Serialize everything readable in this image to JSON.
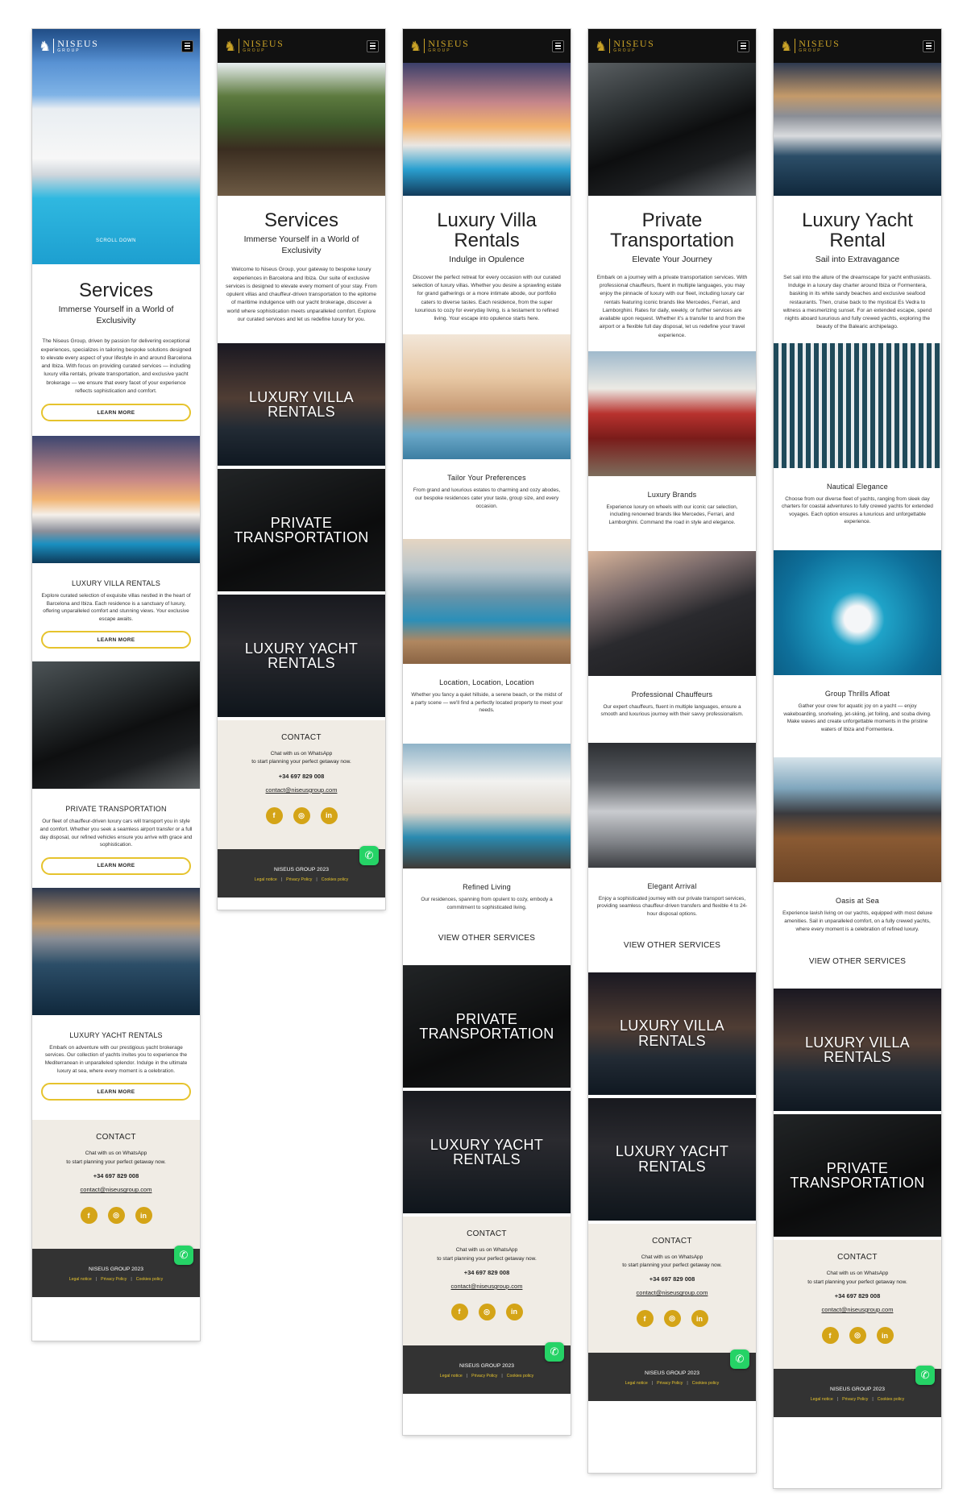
{
  "brand": {
    "name": "NISEUS",
    "tagline": "GROUP"
  },
  "icons": {
    "menu": "hamburger-menu-icon",
    "whatsapp": "whatsapp-icon",
    "facebook": "facebook-icon",
    "instagram": "instagram-icon",
    "linkedin": "linkedin-icon"
  },
  "colors": {
    "gold": "#c9a227",
    "button_border": "#e6c32d",
    "social": "#d4a417",
    "footer": "#333333",
    "contact_bg": "#f0ece5"
  },
  "contact": {
    "heading": "CONTACT",
    "line1": "Chat with us on WhatsApp",
    "line2": "to start planning your perfect getaway now.",
    "phone": "+34 697 829 008",
    "email": "contact@niseusgroup.com",
    "social": [
      "f",
      "◎",
      "in"
    ]
  },
  "footer": {
    "copyright": "NISEUS GROUP 2023",
    "legal": "Legal notice",
    "privacy": "Privacy Policy",
    "cookies": "Cookies policy",
    "sep": "|"
  },
  "home": {
    "scroll": "SCROLL DOWN",
    "title": "Services",
    "subtitle": "Immerse Yourself in a World of Exclusivity",
    "intro": "The Niseus Group, driven by passion for delivering exceptional experiences, specializes in tailoring bespoke solutions designed to elevate every aspect of your lifestyle in and around Barcelona and Ibiza. With focus on providing curated services — including luxury villa rentals, private transportation, and exclusive yacht brokerage — we ensure that every facet of your experience reflects sophistication and comfort.",
    "cta": "LEARN MORE",
    "blocks": [
      {
        "title": "LUXURY VILLA RENTALS",
        "text": "Explore curated selection of exquisite villas nestled in the heart of Barcelona and Ibiza. Each residence is a sanctuary of luxury, offering unparalleled comfort and stunning views. Your exclusive escape awaits.",
        "cta": "LEARN MORE"
      },
      {
        "title": "PRIVATE TRANSPORTATION",
        "text": "Our fleet of chauffeur-driven luxury cars will transport you in style and comfort. Whether you seek a seamless airport transfer or a full day disposal, our refined vehicles ensure you arrive with grace and sophistication.",
        "cta": "LEARN MORE"
      },
      {
        "title": "LUXURY YACHT RENTALS",
        "text": "Embark on adventure with our prestigious yacht brokerage services. Our collection of yachts invites you to experience the Mediterranean in unparalleled splendor. Indulge in the ultimate luxury at sea, where every moment is a celebration.",
        "cta": "LEARN MORE"
      }
    ]
  },
  "services": {
    "title": "Services",
    "subtitle": "Immerse Yourself in a World of Exclusivity",
    "intro": "Welcome to Niseus Group, your gateway to bespoke luxury experiences in Barcelona and Ibiza. Our suite of exclusive services is designed to elevate every moment of your stay. From opulent villas and chauffeur-driven transportation to the epitome of maritime indulgence with our yacht brokerage, discover a world where sophistication meets unparalleled comfort. Explore our curated services and let us redefine luxury for you.",
    "cards": [
      "LUXURY VILLA RENTALS",
      "PRIVATE TRANSPORTATION",
      "LUXURY YACHT RENTALS"
    ]
  },
  "villa": {
    "title": "Luxury Villa Rentals",
    "subtitle": "Indulge in Opulence",
    "intro": "Discover the perfect retreat for every occasion with our curated selection of luxury villas. Whether you desire a sprawling estate for grand gatherings or a more intimate abode, our portfolio caters to diverse tastes. Each residence, from the super luxurious to cozy for everyday living, is a testament to refined living. Your escape into opulence starts here.",
    "features": [
      {
        "title": "Tailor Your Preferences",
        "text": "From grand and luxurious estates to charming and cozy abodes, our bespoke residences cater your taste, group size, and every occasion."
      },
      {
        "title": "Location, Location, Location",
        "text": "Whether you fancy a quiet hillside, a serene beach, or the midst of a party scene — we'll find a perfectly located property to meet your needs."
      },
      {
        "title": "Refined Living",
        "text": "Our residences, spanning from opulent to cozy, embody a commitment to sophisticated living."
      }
    ],
    "other": "VIEW OTHER SERVICES",
    "cards": [
      "PRIVATE TRANSPORTATION",
      "LUXURY YACHT RENTALS"
    ]
  },
  "transport": {
    "title": "Private Transportation",
    "subtitle": "Elevate Your Journey",
    "intro": "Embark on a journey with a private transportation services. With professional chauffeurs, fluent in multiple languages, you may enjoy the pinnacle of luxury with our fleet, including luxury car rentals featuring iconic brands like Mercedes, Ferrari, and Lamborghini. Rates for daily, weekly, or further services are available upon request. Whether it's a transfer to and from the airport or a flexible full day disposal, let us redefine your travel experience.",
    "features": [
      {
        "title": "Luxury Brands",
        "text": "Experience luxury on wheels with our iconic car selection, including renowned brands like Mercedes, Ferrari, and Lamborghini. Command the road in style and elegance."
      },
      {
        "title": "Professional Chauffeurs",
        "text": "Our expert chauffeurs, fluent in multiple languages, ensure a smooth and luxurious journey with their savvy professionalism."
      },
      {
        "title": "Elegant Arrival",
        "text": "Enjoy a sophisticated journey with our private transport services, providing seamless chauffeur-driven transfers and flexible 4 to 24-hour disposal options."
      }
    ],
    "other": "VIEW OTHER SERVICES",
    "cards": [
      "LUXURY VILLA RENTALS",
      "LUXURY YACHT RENTALS"
    ]
  },
  "yacht": {
    "title": "Luxury Yacht Rental",
    "subtitle": "Sail into Extravagance",
    "intro": "Set sail into the allure of the dreamscape for yacht enthusiasts. Indulge in a luxury day charter around Ibiza or Formentera, basking in its white sandy beaches and exclusive seafood restaurants. Then, cruise back to the mystical Es Vedra to witness a mesmerizing sunset. For an extended escape, spend nights aboard luxurious and fully crewed yachts, exploring the beauty of the Balearic archipelago.",
    "features": [
      {
        "title": "Nautical Elegance",
        "text": "Choose from our diverse fleet of yachts, ranging from sleek day charters for coastal adventures to fully crewed yachts for extended voyages. Each option ensures a luxurious and unforgettable experience."
      },
      {
        "title": "Group Thrills Afloat",
        "text": "Gather your crew for aquatic joy on a yacht — enjoy wakeboarding, snorkeling, jet-skiing, jet foiling, and scuba diving. Make waves and create unforgettable moments in the pristine waters of Ibiza and Formentera."
      },
      {
        "title": "Oasis at Sea",
        "text": "Experience lavish living on our yachts, equipped with most deluxe amenities. Sail in unparalleled comfort, on a fully crewed yachts, where every moment is a celebration of refined luxury."
      }
    ],
    "other": "VIEW OTHER SERVICES",
    "cards": [
      "LUXURY VILLA RENTALS",
      "PRIVATE TRANSPORTATION"
    ]
  }
}
